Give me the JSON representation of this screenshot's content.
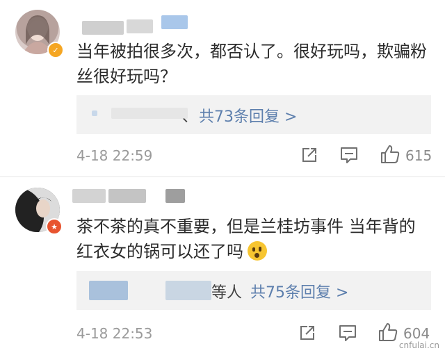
{
  "comments": [
    {
      "text": "当年被拍很多次，都否认了。很好玩吗，欺骗粉丝很好玩吗？",
      "reply_prefix": "、",
      "reply_link": "共73条回复 >",
      "time": "4-18 22:59",
      "likes": "615",
      "badge_color": "#f5a623"
    },
    {
      "text": "茶不茶的真不重要，但是兰桂坊事件 当年背的红衣女的锅可以还了吗",
      "reply_prefix": "等人",
      "reply_link": "共75条回复 >",
      "time": "4-18 22:53",
      "likes": "604",
      "badge_color": "#e8542f"
    }
  ],
  "watermark": "cnfulai.cn",
  "icons": [
    "share-icon",
    "comment-icon",
    "like-icon",
    "emoji-icon"
  ],
  "colors": {
    "link": "#5d7fad",
    "reply_bg": "#f2f2f2",
    "time": "#9a9a9a"
  }
}
